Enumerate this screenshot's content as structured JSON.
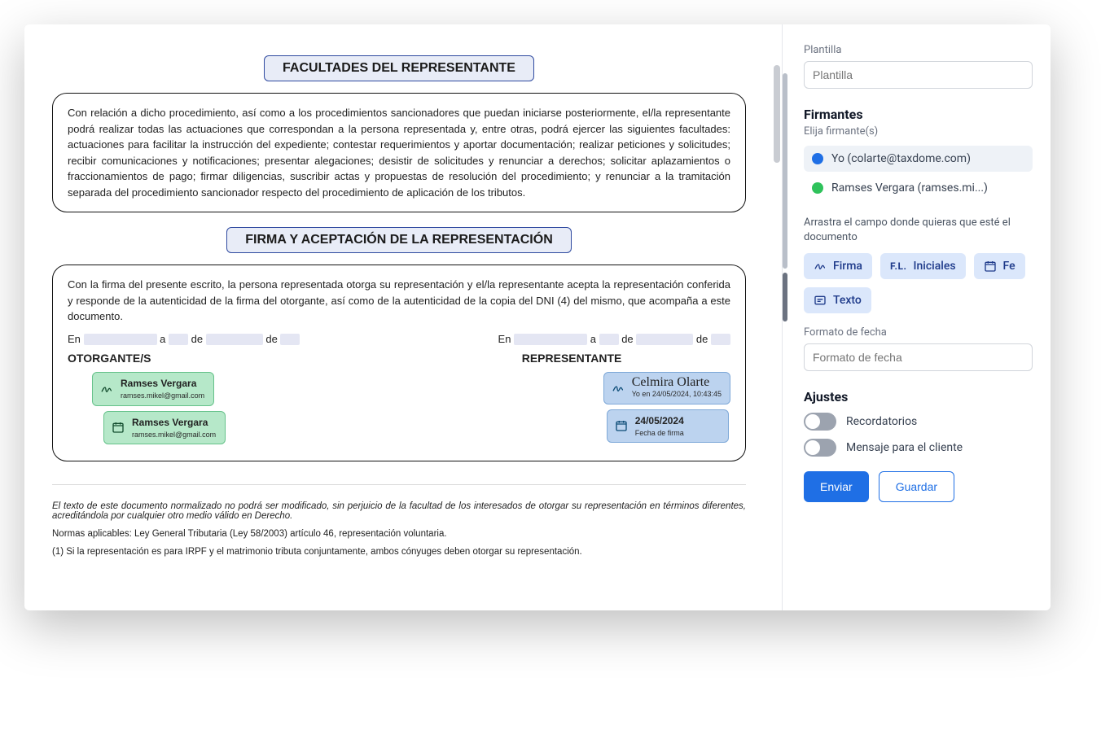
{
  "doc": {
    "section1_title": "FACULTADES DEL REPRESENTANTE",
    "section1_body": "Con relación a dicho procedimiento, así como a los procedimientos sancionadores que puedan iniciarse posteriormente, el/la representante podrá realizar todas las actuaciones que correspondan a la persona representada y, entre otras, podrá ejercer las siguientes facultades: actuaciones para facilitar la instrucción del expediente; contestar requerimientos y aportar documentación; realizar peticiones y solicitudes; recibir comunicaciones y notificaciones; presentar alegaciones; desistir de solicitudes y renunciar a derechos; solicitar aplazamientos o fraccionamientos de pago; firmar diligencias, suscribir actas y propuestas de resolución del procedimiento; y renunciar a la tramitación separada del procedimiento sancionador respecto del procedimiento de aplicación de los tributos.",
    "section2_title": "FIRMA Y ACEPTACIÓN DE LA REPRESENTACIÓN",
    "section2_body": "Con la firma del presente escrito, la persona representada otorga su representación y el/la representante acepta la representación conferida y responde de la autenticidad de la firma del otorgante, así como de la autenticidad de la copia del DNI (4) del mismo, que acompaña a este documento.",
    "en": "En",
    "a": "a",
    "de": "de",
    "otorgante_title": "OTORGANTE/S",
    "representante_title": "REPRESENTANTE",
    "sig_green1_name": "Ramses Vergara",
    "sig_green1_sub": "ramses.mikel@gmail.com",
    "sig_green2_name": "Ramses Vergara",
    "sig_green2_sub": "ramses.mikel@gmail.com",
    "sig_blue1_name": "Celmira Olarte",
    "sig_blue1_sub": "Yo en 24/05/2024, 10:43:45",
    "sig_blue2_name": "24/05/2024",
    "sig_blue2_sub": "Fecha de firma",
    "foot1": "El texto de este documento normalizado no podrá ser modificado, sin perjuicio de la facultad de los interesados de otorgar su representación en términos diferentes, acreditándola por cualquier otro medio válido en Derecho.",
    "foot2": "Normas aplicables: Ley General Tributaria (Ley 58/2003) artículo 46, representación voluntaria.",
    "foot3": "(1) Si la representación es para IRPF y el matrimonio tributa conjuntamente, ambos cónyuges deben otorgar su representación."
  },
  "side": {
    "template_label": "Plantilla",
    "template_placeholder": "Plantilla",
    "signers_title": "Firmantes",
    "signers_sub": "Elija firmante(s)",
    "signer1": "Yo (colarte@taxdome.com)",
    "signer2": "Ramses Vergara (ramses.mi...)",
    "drag_hint": "Arrastra el campo donde quieras que esté el documento",
    "chip_firma": "Firma",
    "chip_iniciales": "Iniciales",
    "chip_fecha": "Fe",
    "chip_texto": "Texto",
    "date_format_label": "Formato de fecha",
    "date_format_placeholder": "Formato de fecha",
    "settings_title": "Ajustes",
    "toggle1": "Recordatorios",
    "toggle2": "Mensaje para el cliente",
    "btn_send": "Enviar",
    "btn_save": "Guardar"
  }
}
